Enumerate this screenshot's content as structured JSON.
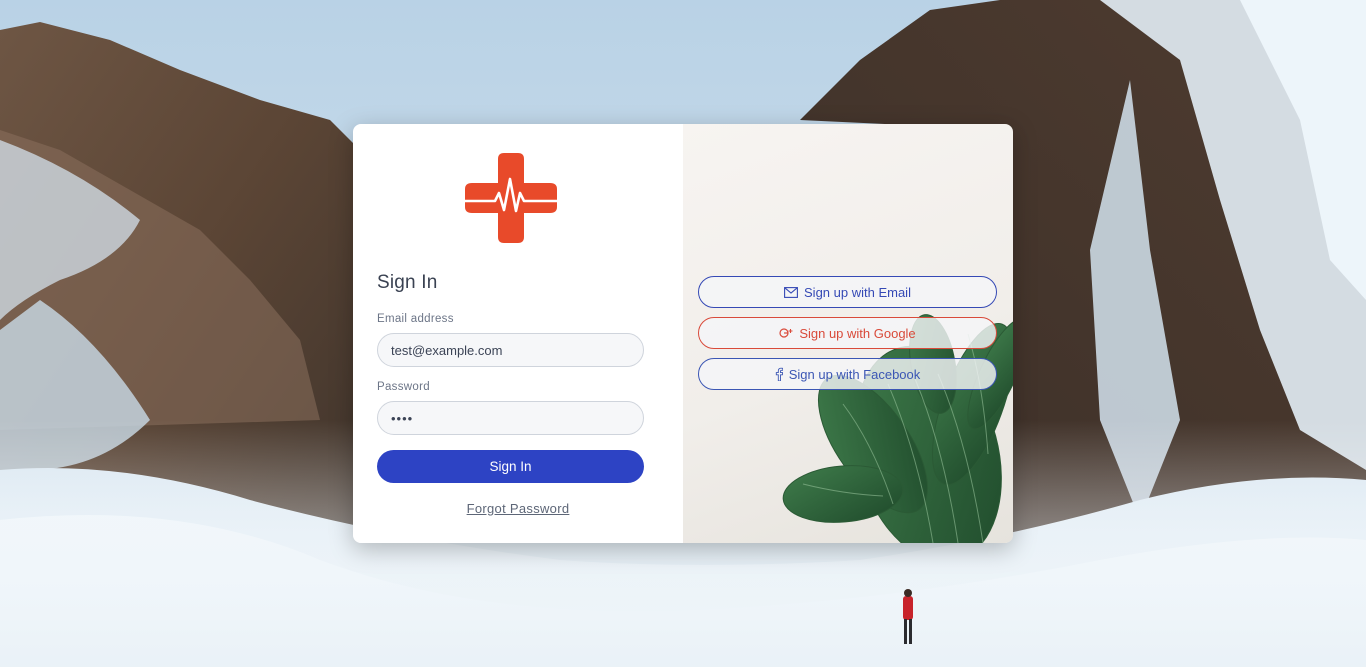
{
  "brand": {
    "logo_icon": "medical-cross-heartbeat-icon",
    "logo_color": "#e84a2a"
  },
  "signin": {
    "title": "Sign In",
    "email_label": "Email address",
    "email_value": "test@example.com",
    "password_label": "Password",
    "password_value": "••••",
    "submit_label": "Sign In",
    "forgot_label": "Forgot Password"
  },
  "social": {
    "email": {
      "label": "Sign up with Email",
      "icon": "envelope-icon",
      "color": "#3549b5"
    },
    "google": {
      "label": "Sign up with Google",
      "icon": "google-plus-icon",
      "color": "#d94a3a"
    },
    "facebook": {
      "label": "Sign up with Facebook",
      "icon": "facebook-icon",
      "color": "#3b56b4"
    }
  },
  "colors": {
    "primary": "#2d43c4"
  }
}
